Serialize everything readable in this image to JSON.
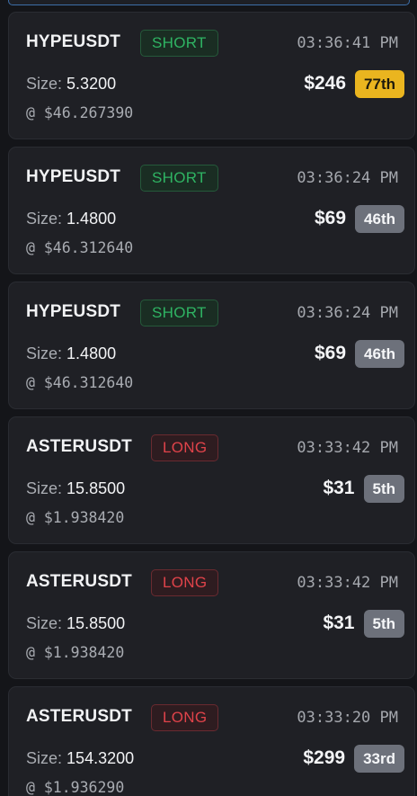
{
  "trades": [
    {
      "symbol": "HYPEUSDT",
      "side": "SHORT",
      "time": "03:36:41 PM",
      "size_label": "Size:",
      "size": "5.3200",
      "price": "@ $46.267390",
      "usd": "$246",
      "rank": "77th",
      "rank_color": "#eab51f"
    },
    {
      "symbol": "HYPEUSDT",
      "side": "SHORT",
      "time": "03:36:24 PM",
      "size_label": "Size:",
      "size": "1.4800",
      "price": "@ $46.312640",
      "usd": "$69",
      "rank": "46th",
      "rank_color": "#6d717b"
    },
    {
      "symbol": "HYPEUSDT",
      "side": "SHORT",
      "time": "03:36:24 PM",
      "size_label": "Size:",
      "size": "1.4800",
      "price": "@ $46.312640",
      "usd": "$69",
      "rank": "46th",
      "rank_color": "#6d717b"
    },
    {
      "symbol": "ASTERUSDT",
      "side": "LONG",
      "time": "03:33:42 PM",
      "size_label": "Size:",
      "size": "15.8500",
      "price": "@ $1.938420",
      "usd": "$31",
      "rank": "5th",
      "rank_color": "#6d717b"
    },
    {
      "symbol": "ASTERUSDT",
      "side": "LONG",
      "time": "03:33:42 PM",
      "size_label": "Size:",
      "size": "15.8500",
      "price": "@ $1.938420",
      "usd": "$31",
      "rank": "5th",
      "rank_color": "#6d717b"
    },
    {
      "symbol": "ASTERUSDT",
      "side": "LONG",
      "time": "03:33:20 PM",
      "size_label": "Size:",
      "size": "154.3200",
      "price": "@ $1.936290",
      "usd": "$299",
      "rank": "33rd",
      "rank_color": "#6d717b"
    }
  ],
  "colors": {
    "background": "#141519",
    "card": "#1f2025",
    "short": "#2fb463",
    "long": "#e0434a",
    "rank_gold": "#eab51f",
    "rank_gray": "#6d717b"
  }
}
